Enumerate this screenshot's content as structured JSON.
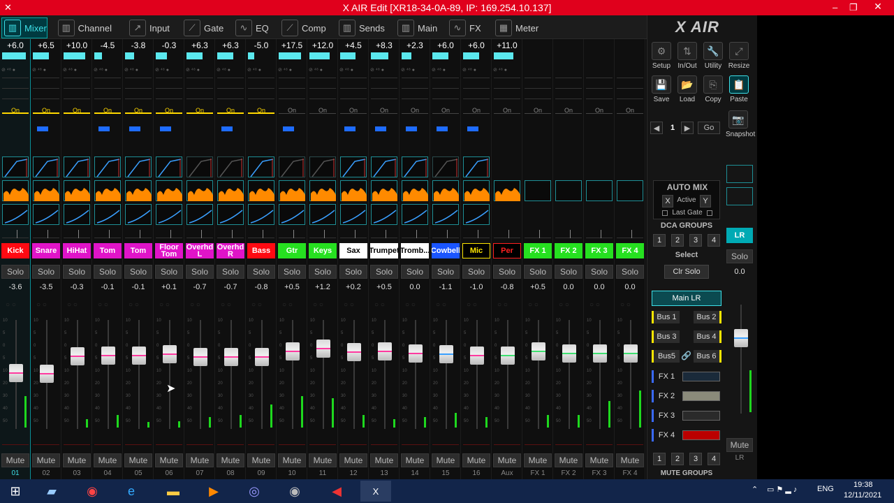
{
  "window": {
    "title": "X AIR Edit [XR18-34-0A-89, IP: 169.254.10.137]",
    "minimize": "–",
    "restore": "❐",
    "close": "✕"
  },
  "tabs": [
    {
      "label": "Mixer",
      "icon": "mixer-icon",
      "glyph": "▥",
      "active": true
    },
    {
      "label": "Channel",
      "icon": "channel-icon",
      "glyph": "▥",
      "active": false
    },
    {
      "label": "Input",
      "icon": "input-icon",
      "glyph": "↗",
      "active": false
    },
    {
      "label": "Gate",
      "icon": "gate-icon",
      "glyph": "⟋",
      "active": false
    },
    {
      "label": "EQ",
      "icon": "eq-icon",
      "glyph": "∿",
      "active": false
    },
    {
      "label": "Comp",
      "icon": "comp-icon",
      "glyph": "⟋",
      "active": false
    },
    {
      "label": "Sends",
      "icon": "sends-icon",
      "glyph": "▥",
      "active": false
    },
    {
      "label": "Main",
      "icon": "main-icon",
      "glyph": "▥",
      "active": false
    },
    {
      "label": "FX",
      "icon": "fx-icon",
      "glyph": "∿",
      "active": false
    },
    {
      "label": "Meter",
      "icon": "meter-icon",
      "glyph": "▦",
      "active": false
    }
  ],
  "channels": [
    {
      "trim": "+6.0",
      "trim_level": 0.95,
      "name": "Kick",
      "bg": "#ff0a12",
      "fg": "#ffffff",
      "on_label": "On",
      "on_yellow": true,
      "solo": "Solo",
      "db": "-3.6",
      "fader": 0.58,
      "meter": 0.3,
      "mute": "Mute",
      "num": "01",
      "blue": false,
      "gate": true,
      "gate_color": "#3aa0ff",
      "lowcut": true,
      "selected": true
    },
    {
      "trim": "+6.5",
      "trim_level": 0.65,
      "name": "Snare",
      "bg": "#e014c8",
      "fg": "#ffffff",
      "on_label": "On",
      "on_yellow": true,
      "solo": "Solo",
      "db": "-3.5",
      "fader": 0.57,
      "meter": 0.0,
      "mute": "Mute",
      "num": "02",
      "blue": true,
      "gate": true,
      "gate_color": "#3aa0ff",
      "lowcut": true,
      "selected": false
    },
    {
      "trim": "+10.0",
      "trim_level": 0.85,
      "name": "HiHat",
      "bg": "#e014c8",
      "fg": "#ffffff",
      "on_label": "On",
      "on_yellow": true,
      "solo": "Solo",
      "db": "-0.3",
      "fader": 0.75,
      "meter": 0.08,
      "mute": "Mute",
      "num": "03",
      "blue": false,
      "gate": true,
      "gate_color": "#3aa0ff",
      "lowcut": true,
      "selected": false
    },
    {
      "trim": "-4.5",
      "trim_level": 0.3,
      "name": "Tom",
      "bg": "#e014c8",
      "fg": "#ffffff",
      "on_label": "On",
      "on_yellow": true,
      "solo": "Solo",
      "db": "-0.1",
      "fader": 0.76,
      "meter": 0.12,
      "mute": "Mute",
      "num": "04",
      "blue": true,
      "gate": true,
      "gate_color": "#3aa0ff",
      "lowcut": true,
      "selected": false
    },
    {
      "trim": "-3.8",
      "trim_level": 0.35,
      "name": "Tom",
      "bg": "#e014c8",
      "fg": "#ffffff",
      "on_label": "On",
      "on_yellow": true,
      "solo": "Solo",
      "db": "-0.1",
      "fader": 0.76,
      "meter": 0.05,
      "mute": "Mute",
      "num": "05",
      "blue": true,
      "gate": true,
      "gate_color": "#3aa0ff",
      "lowcut": true,
      "selected": false
    },
    {
      "trim": "-0.3",
      "trim_level": 0.45,
      "name": "Floor Tom",
      "bg": "#e014c8",
      "fg": "#ffffff",
      "on_label": "On",
      "on_yellow": true,
      "solo": "Solo",
      "db": "+0.1",
      "fader": 0.77,
      "meter": 0.06,
      "mute": "Mute",
      "num": "06",
      "blue": true,
      "gate": true,
      "gate_color": "#3aa0ff",
      "lowcut": true,
      "selected": false
    },
    {
      "trim": "+6.3",
      "trim_level": 0.65,
      "name": "Overhd L",
      "bg": "#e014c8",
      "fg": "#ffffff",
      "on_label": "On",
      "on_yellow": true,
      "solo": "Solo",
      "db": "-0.7",
      "fader": 0.74,
      "meter": 0.1,
      "mute": "Mute",
      "num": "07",
      "blue": false,
      "gate": false,
      "gate_color": "#555555",
      "lowcut": true,
      "selected": false
    },
    {
      "trim": "+6.3",
      "trim_level": 0.65,
      "name": "Overhd R",
      "bg": "#e014c8",
      "fg": "#ffffff",
      "on_label": "On",
      "on_yellow": true,
      "solo": "Solo",
      "db": "-0.7",
      "fader": 0.74,
      "meter": 0.12,
      "mute": "Mute",
      "num": "08",
      "blue": true,
      "gate": false,
      "gate_color": "#555555",
      "lowcut": true,
      "selected": false
    },
    {
      "trim": "-5.0",
      "trim_level": 0.25,
      "name": "Bass",
      "bg": "#ff0a12",
      "fg": "#ffffff",
      "on_label": "On",
      "on_yellow": true,
      "solo": "Solo",
      "db": "-0.8",
      "fader": 0.74,
      "meter": 0.22,
      "mute": "Mute",
      "num": "09",
      "blue": false,
      "gate": true,
      "gate_color": "#3aa0ff",
      "lowcut": true,
      "selected": false
    },
    {
      "trim": "+17.5",
      "trim_level": 0.9,
      "name": "Gtr",
      "bg": "#26e020",
      "fg": "#ffffff",
      "on_label": "On",
      "on_yellow": false,
      "solo": "Solo",
      "db": "+0.5",
      "fader": 0.8,
      "meter": 0.3,
      "mute": "Mute",
      "num": "10",
      "blue": true,
      "gate": false,
      "gate_color": "#555555",
      "lowcut": true,
      "selected": false
    },
    {
      "trim": "+12.0",
      "trim_level": 0.8,
      "name": "Keys",
      "bg": "#26e020",
      "fg": "#ffffff",
      "on_label": "On",
      "on_yellow": false,
      "solo": "Solo",
      "db": "+1.2",
      "fader": 0.83,
      "meter": 0.28,
      "mute": "Mute",
      "num": "11",
      "blue": false,
      "gate": false,
      "gate_color": "#555555",
      "lowcut": true,
      "selected": false
    },
    {
      "trim": "+4.5",
      "trim_level": 0.6,
      "name": "Sax",
      "bg": "#ffffff",
      "fg": "#000000",
      "on_label": "On",
      "on_yellow": false,
      "solo": "Solo",
      "db": "+0.2",
      "fader": 0.79,
      "meter": 0.12,
      "mute": "Mute",
      "num": "12",
      "blue": true,
      "gate": true,
      "gate_color": "#3aa0ff",
      "lowcut": true,
      "selected": false
    },
    {
      "trim": "+8.3",
      "trim_level": 0.7,
      "name": "Trumpet",
      "bg": "#ffffff",
      "fg": "#000000",
      "on_label": "On",
      "on_yellow": false,
      "solo": "Solo",
      "db": "+0.5",
      "fader": 0.8,
      "meter": 0.08,
      "mute": "Mute",
      "num": "13",
      "blue": true,
      "gate": true,
      "gate_color": "#3aa0ff",
      "lowcut": true,
      "selected": false
    },
    {
      "trim": "+2.3",
      "trim_level": 0.4,
      "name": "Tromb...",
      "bg": "#ffffff",
      "fg": "#000000",
      "on_label": "On",
      "on_yellow": false,
      "solo": "Solo",
      "db": "0.0",
      "fader": 0.78,
      "meter": 0.1,
      "mute": "Mute",
      "num": "14",
      "blue": true,
      "gate": true,
      "gate_color": "#3aa0ff",
      "lowcut": true,
      "selected": false
    },
    {
      "trim": "+6.0",
      "trim_level": 0.65,
      "name": "Cowbell",
      "bg": "#1a55ff",
      "fg": "#ffffff",
      "on_label": "On",
      "on_yellow": false,
      "solo": "Solo",
      "db": "-1.1",
      "fader": 0.77,
      "meter": 0.14,
      "mute": "Mute",
      "num": "15",
      "blue": true,
      "gate": false,
      "gate_color": "#555555",
      "lowcut": true,
      "selected": false
    },
    {
      "trim": "+6.0",
      "trim_level": 0.65,
      "name": "Mic",
      "bg": "#000000",
      "fg": "#ffe600",
      "on_label": "On",
      "on_yellow": false,
      "solo": "Solo",
      "db": "-1.0",
      "fader": 0.76,
      "meter": 0.1,
      "mute": "Mute",
      "num": "16",
      "blue": true,
      "gate": true,
      "gate_color": "#3aa0ff",
      "lowcut": true,
      "selected": false
    },
    {
      "trim": "+11.0",
      "trim_level": 0.78,
      "name": "Per",
      "bg": "#000000",
      "fg": "#ff2020",
      "on_label": "On",
      "on_yellow": false,
      "solo": "Solo",
      "db": "-0.8",
      "fader": 0.76,
      "meter": 0.0,
      "mute": "Mute",
      "num": "Aux",
      "blue": false,
      "gate": false,
      "gate_color": "#555555",
      "lowcut": false,
      "selected": false
    },
    {
      "trim": "",
      "trim_level": 0,
      "name": "FX 1",
      "bg": "#26e020",
      "fg": "#ffffff",
      "on_label": "On",
      "on_yellow": false,
      "solo": "Solo",
      "db": "+0.5",
      "fader": 0.8,
      "meter": 0.12,
      "mute": "Mute",
      "num": "FX 1",
      "blue": false,
      "gate": false,
      "gate_color": "#555555",
      "lowcut": false,
      "selected": false
    },
    {
      "trim": "",
      "trim_level": 0,
      "name": "FX 2",
      "bg": "#26e020",
      "fg": "#ffffff",
      "on_label": "On",
      "on_yellow": false,
      "solo": "Solo",
      "db": "0.0",
      "fader": 0.78,
      "meter": 0.12,
      "mute": "Mute",
      "num": "FX 2",
      "blue": false,
      "gate": false,
      "gate_color": "#555555",
      "lowcut": false,
      "selected": false
    },
    {
      "trim": "",
      "trim_level": 0,
      "name": "FX 3",
      "bg": "#26e020",
      "fg": "#ffffff",
      "on_label": "On",
      "on_yellow": false,
      "solo": "Solo",
      "db": "0.0",
      "fader": 0.78,
      "meter": 0.25,
      "mute": "Mute",
      "num": "FX 3",
      "blue": false,
      "gate": false,
      "gate_color": "#555555",
      "lowcut": false,
      "selected": false
    },
    {
      "trim": "",
      "trim_level": 0,
      "name": "FX 4",
      "bg": "#26e020",
      "fg": "#ffffff",
      "on_label": "On",
      "on_yellow": false,
      "solo": "Solo",
      "db": "0.0",
      "fader": 0.78,
      "meter": 0.35,
      "mute": "Mute",
      "num": "FX 4",
      "blue": false,
      "gate": false,
      "gate_color": "#555555",
      "lowcut": false,
      "selected": false
    }
  ],
  "fader_scale": [
    "10",
    "5",
    "0",
    "5",
    "10",
    "20",
    "30",
    "40",
    "50"
  ],
  "right": {
    "logo": "X AIR",
    "row1": [
      {
        "label": "Setup",
        "icon": "setup-icon",
        "glyph": "⚙"
      },
      {
        "label": "In/Out",
        "icon": "in-out-icon",
        "glyph": "⇅"
      },
      {
        "label": "Utility",
        "icon": "utility-icon",
        "glyph": "🔧"
      },
      {
        "label": "Resize",
        "icon": "resize-icon",
        "glyph": "⤢"
      }
    ],
    "row2": [
      {
        "label": "Save",
        "icon": "save-icon",
        "glyph": "💾"
      },
      {
        "label": "Load",
        "icon": "load-icon",
        "glyph": "📂"
      },
      {
        "label": "Copy",
        "icon": "copy-icon",
        "glyph": "⎘"
      },
      {
        "label": "Paste",
        "icon": "paste-icon",
        "glyph": "📋"
      }
    ],
    "snapshot_num": "1",
    "go": "Go",
    "snapshot": "Snapshot",
    "automix_title": "AUTO MIX",
    "automix_x": "X",
    "automix_active": "Active",
    "automix_y": "Y",
    "last_gate": "Last Gate",
    "dca_title": "DCA GROUPS",
    "dca": [
      "1",
      "2",
      "3",
      "4"
    ],
    "select": "Select",
    "clr_solo": "Clr Solo",
    "main_lr": "Main LR",
    "buses": [
      "Bus 1",
      "Bus 2",
      "Bus 3",
      "Bus 4",
      "Bus5",
      "Bus 6"
    ],
    "fx": [
      "FX 1",
      "FX 2",
      "FX 3",
      "FX 4"
    ],
    "mute_groups": [
      "1",
      "2",
      "3",
      "4"
    ],
    "mute_groups_title": "MUTE GROUPS"
  },
  "lr": {
    "name": "LR",
    "solo": "Solo",
    "db": "0.0",
    "fader": 0.78,
    "mute": "Mute",
    "num": "LR"
  },
  "taskbar": {
    "lang": "ENG",
    "time": "19:38",
    "date": "12/11/2021"
  }
}
